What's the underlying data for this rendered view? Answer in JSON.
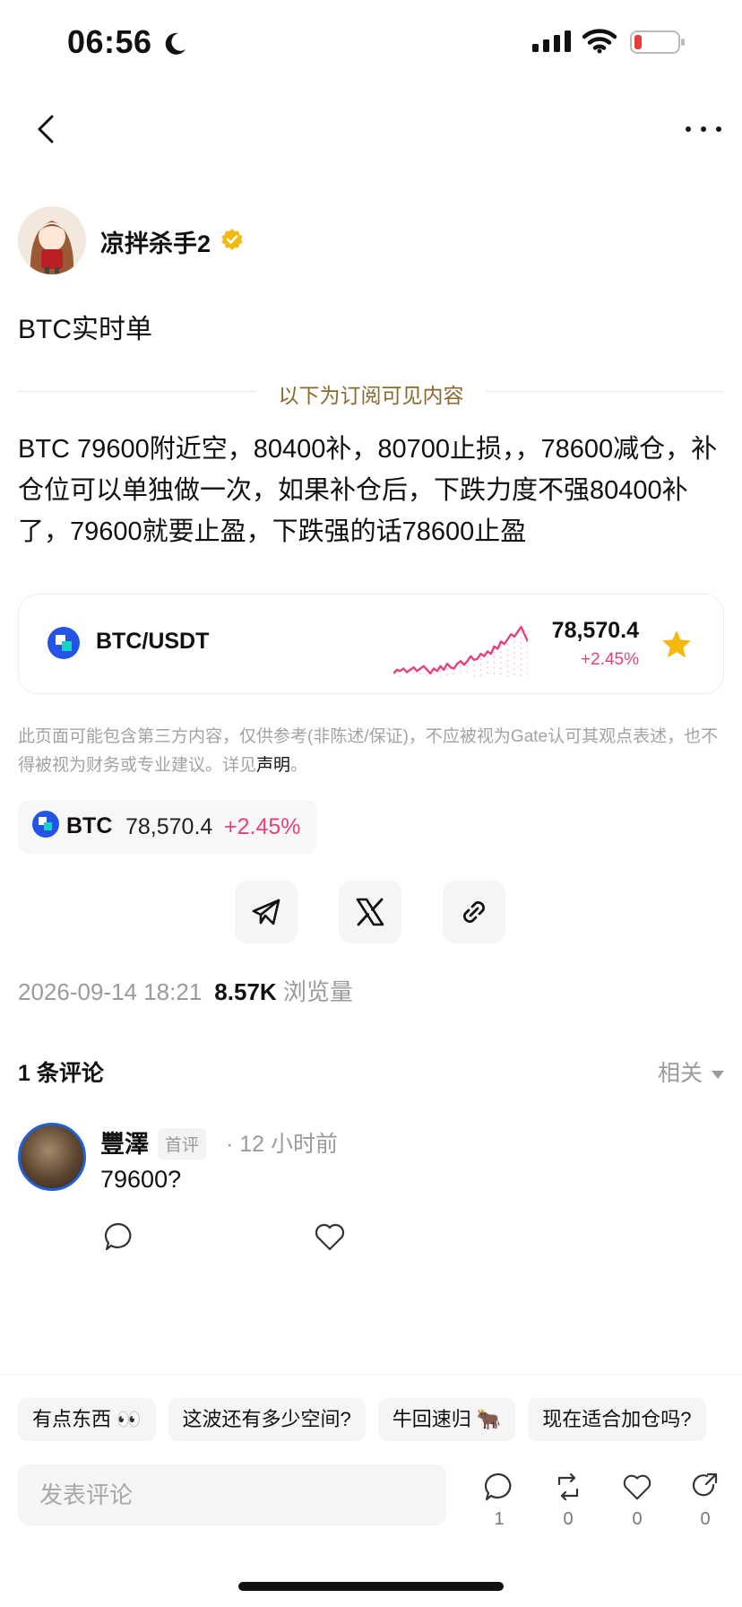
{
  "status_bar": {
    "time": "06:56"
  },
  "author": {
    "name": "凉拌杀手2"
  },
  "post": {
    "title": "BTC实时单",
    "subscriber_divider": "以下为订阅可见内容",
    "body": "BTC 79600附近空，80400补，80700止损，，78600减仓，补仓位可以单独做一次，如果补仓后，下跌力度不强80400补了，79600就要止盈，下跌强的话78600止盈"
  },
  "ticker": {
    "pair": "BTC/USDT",
    "price": "78,570.4",
    "change": "+2.45%",
    "sparkline": [
      52,
      55,
      54,
      56,
      53,
      55,
      57,
      54,
      56,
      58,
      55,
      52,
      56,
      54,
      58,
      55,
      60,
      57,
      56,
      60,
      62,
      59,
      62,
      66,
      63,
      64,
      68,
      66,
      70,
      68,
      74,
      72,
      78,
      76,
      80,
      84,
      82,
      86,
      90,
      84,
      78
    ],
    "colors": {
      "up": "#e8407a",
      "coin": "#2354e6",
      "coin_accent": "#17d3c2",
      "star": "#f5b80f"
    }
  },
  "disclaimer": {
    "text": "此页面可能包含第三方内容，仅供参考(非陈述/保证)，不应被视为Gate认可其观点表述，也不得被视为财务或专业建议。详见",
    "link": "声明",
    "suffix": "。"
  },
  "coin_chip": {
    "symbol": "BTC",
    "price": "78,570.4",
    "change": "+2.45%"
  },
  "share": {
    "icons": [
      "telegram-icon",
      "x-icon",
      "link-icon"
    ]
  },
  "meta": {
    "datetime": "2026-09-14 18:21",
    "views": "8.57K",
    "views_label": "浏览量"
  },
  "comments": {
    "count_label": "1 条评论",
    "sort_label": "相关",
    "items": [
      {
        "user": "豐澤",
        "badge": "首评",
        "time": "· 12 小时前",
        "text": "79600?"
      }
    ]
  },
  "quick_replies": [
    "有点东西 👀",
    "这波还有多少空间?",
    "牛回速归 🐂",
    "现在适合加仓吗?"
  ],
  "input": {
    "placeholder": "发表评论"
  },
  "actions": {
    "comments": "1",
    "reposts": "0",
    "likes": "0",
    "shares": "0"
  }
}
